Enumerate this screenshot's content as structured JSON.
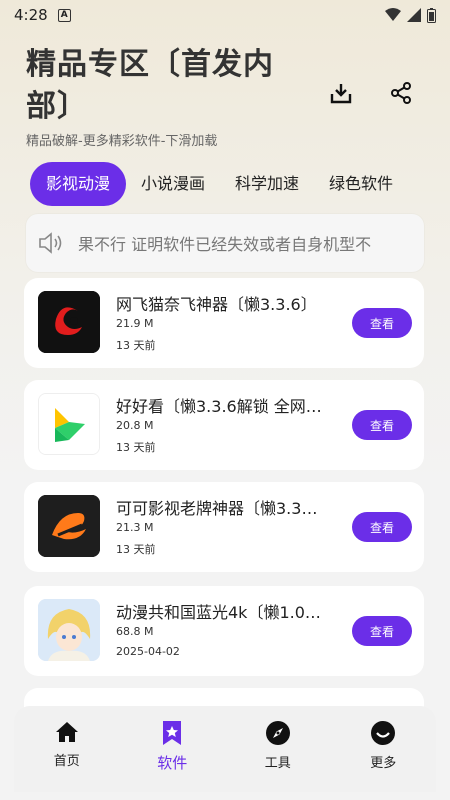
{
  "status_bar": {
    "time": "4:28",
    "notif_letter": "A"
  },
  "header": {
    "title_line1": "精品专区〔首发内",
    "title_line2": "部〕",
    "subtitle": "精品破解-更多精彩软件-下滑加载"
  },
  "tabs": [
    {
      "label": "影视动漫",
      "active": true
    },
    {
      "label": "小说漫画",
      "active": false
    },
    {
      "label": "科学加速",
      "active": false
    },
    {
      "label": "绿色软件",
      "active": false
    }
  ],
  "notice": {
    "text": "果不行 证明软件已经失效或者自身机型不"
  },
  "apps": [
    {
      "name": "网飞猫奈飞神器〔懒3.3.6〕",
      "size": "21.9 M",
      "date": "13 天前",
      "button": "查看",
      "icon": "netflix-cat-icon"
    },
    {
      "name": "好好看〔懒3.3.6解锁 全网…",
      "size": "20.8 M",
      "date": "13 天前",
      "button": "查看",
      "icon": "haohaokan-icon"
    },
    {
      "name": "可可影视老牌神器〔懒3.3…",
      "size": "21.3 M",
      "date": "13 天前",
      "button": "查看",
      "icon": "keke-icon"
    },
    {
      "name": "动漫共和国蓝光4k〔懒1.0…",
      "size": "68.8 M",
      "date": "2025-04-02",
      "button": "查看",
      "icon": "anime-avatar-icon"
    }
  ],
  "bottom_nav": [
    {
      "label": "首页",
      "icon": "home-icon",
      "active": false
    },
    {
      "label": "软件",
      "icon": "software-icon",
      "active": true
    },
    {
      "label": "工具",
      "icon": "compass-icon",
      "active": false
    },
    {
      "label": "更多",
      "icon": "more-icon",
      "active": false
    }
  ],
  "colors": {
    "accent": "#6b2ee8",
    "background": "#f3f3f3"
  }
}
